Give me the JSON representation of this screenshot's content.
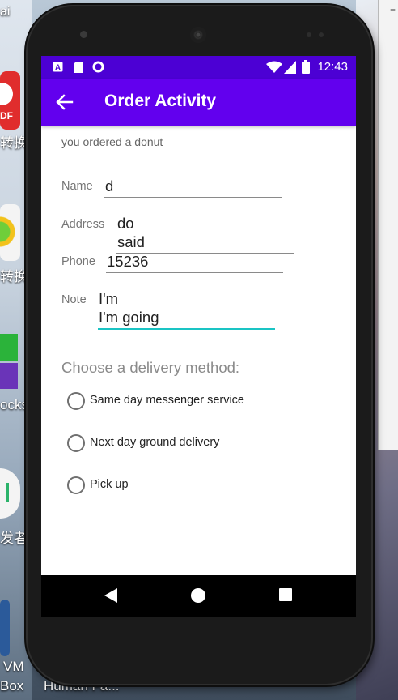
{
  "desktop": {
    "top_left_text": "ai",
    "icon1_label": "DF",
    "label_1": "转换",
    "label_2": "转换",
    "label_3": "ocks",
    "label_4": "发者工",
    "taskbar_left_1": "VM",
    "taskbar_left_2": "Box",
    "taskbar_label": "Human Fa...",
    "window_dash": "–"
  },
  "status_bar": {
    "time": "12:43",
    "icons": [
      "a-notification-icon",
      "sd-card-icon",
      "circle-notification-icon",
      "wifi-icon",
      "signal-icon",
      "battery-icon"
    ]
  },
  "app_bar": {
    "title": "Order Activity",
    "back_icon": "arrow-back-icon",
    "color": "#6200ee",
    "status_color": "#4c00d4"
  },
  "order": {
    "message": "you ordered a donut",
    "name_label": "Name",
    "name_value": "d",
    "address_label": "Address",
    "address_line1": "do",
    "address_line2": "said",
    "phone_label": "Phone",
    "phone_value": "15236",
    "note_label": "Note",
    "note_line1": "I'm",
    "note_line2": "I'm going",
    "focus_color": "#1ac4c4"
  },
  "delivery": {
    "heading": "Choose a delivery method:",
    "options": [
      {
        "label": "Same day messenger service",
        "selected": false
      },
      {
        "label": "Next day ground delivery",
        "selected": false
      },
      {
        "label": "Pick up",
        "selected": false
      }
    ]
  },
  "nav_bar": {
    "buttons": [
      "back-triangle-icon",
      "home-circle-icon",
      "recents-square-icon"
    ]
  }
}
